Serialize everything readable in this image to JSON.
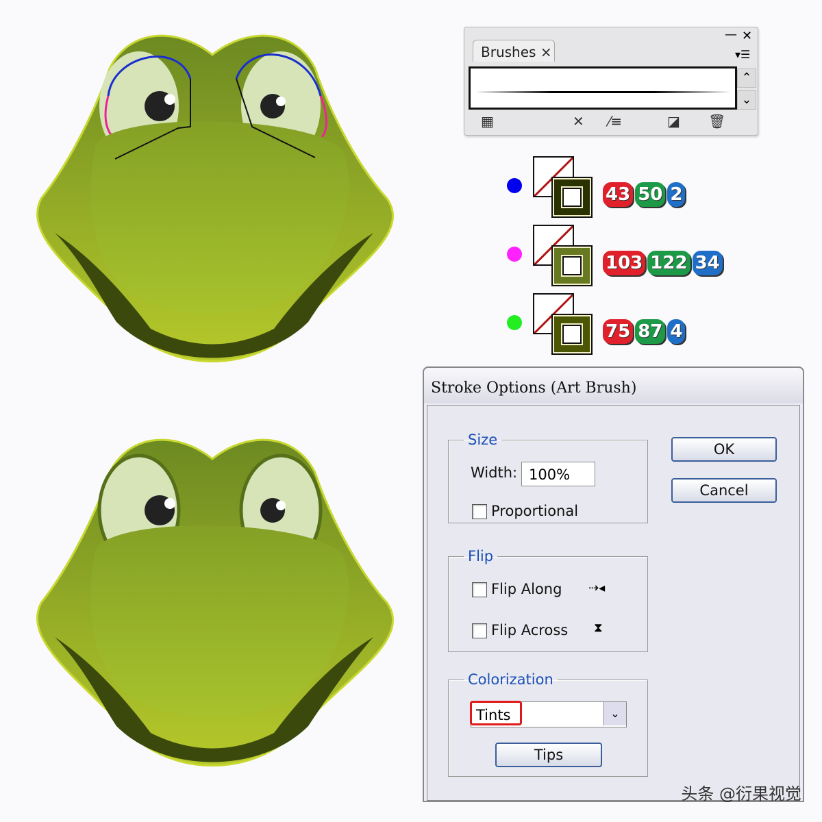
{
  "brushes_panel": {
    "tab_label": "Brushes",
    "close_tab": "×",
    "minimize": "—",
    "close": "✕",
    "menu": "▾☰",
    "icons": [
      "brush-libraries-icon",
      "remove-brush-stroke-icon",
      "brush-options-icon",
      "new-brush-icon",
      "delete-brush-icon"
    ]
  },
  "swatches": [
    {
      "marker_color": "#0000ee",
      "stroke_color": "#2b3202",
      "r": "43",
      "g": "50",
      "b": "2"
    },
    {
      "marker_color": "#ff22ff",
      "stroke_color": "#677a22",
      "r": "103",
      "g": "122",
      "b": "34"
    },
    {
      "marker_color": "#22ee22",
      "stroke_color": "#4b5704",
      "r": "75",
      "g": "87",
      "b": "4"
    }
  ],
  "dialog": {
    "title": "Stroke Options (Art Brush)",
    "size": {
      "legend": "Size",
      "width_label": "Width:",
      "width_value": "100%",
      "proportional": "Proportional",
      "proportional_checked": false
    },
    "flip": {
      "legend": "Flip",
      "along": "Flip Along",
      "across": "Flip Across",
      "along_checked": false,
      "across_checked": false
    },
    "colorization": {
      "legend": "Colorization",
      "method": "Tints",
      "tips": "Tips"
    },
    "ok": "OK",
    "cancel": "Cancel"
  },
  "watermark": "头条 @衍果视觉"
}
